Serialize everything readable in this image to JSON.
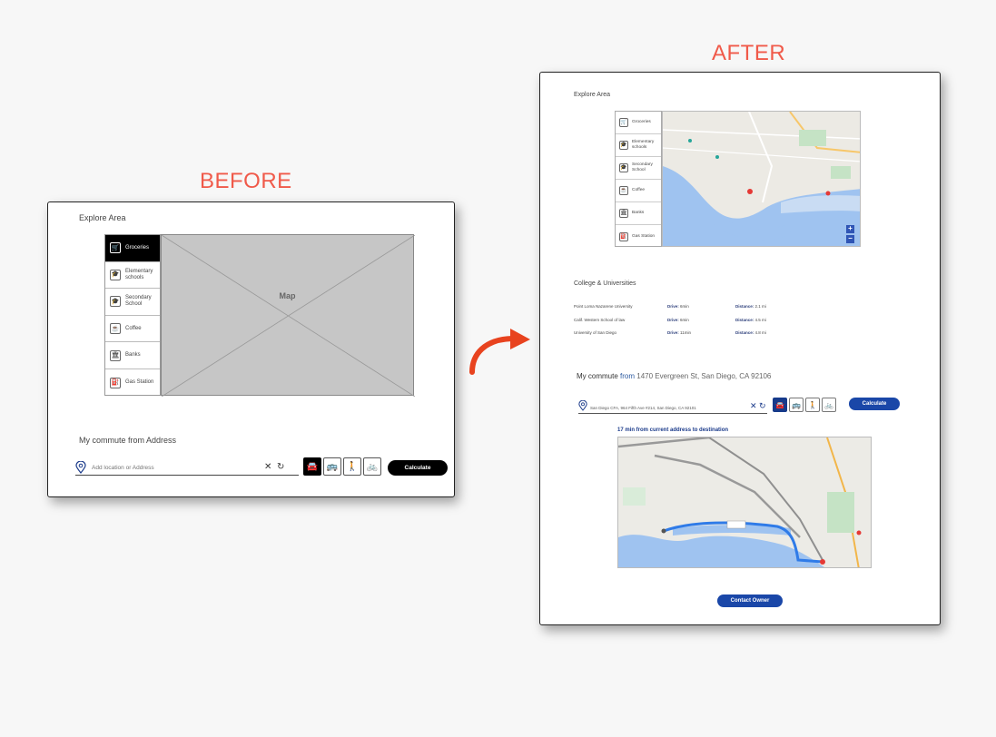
{
  "before": {
    "heading": "BEFORE",
    "explore_title": "Explore Area",
    "sidebar": [
      {
        "label": "Groceries",
        "icon": "cart-icon",
        "glyph": "🛒",
        "active": true
      },
      {
        "label": "Elementary schools",
        "icon": "school-icon",
        "glyph": "🎓",
        "active": false
      },
      {
        "label": "Secondary School",
        "icon": "school-icon",
        "glyph": "🎓",
        "active": false
      },
      {
        "label": "Coffee",
        "icon": "coffee-icon",
        "glyph": "☕",
        "active": false
      },
      {
        "label": "Banks",
        "icon": "bank-icon",
        "glyph": "🏛",
        "active": false
      },
      {
        "label": "Gas Station",
        "icon": "gas-station-icon",
        "glyph": "⛽",
        "active": false
      }
    ],
    "map_label": "Map",
    "commute_title": "My commute from Address",
    "input_placeholder": "Add location or Address",
    "calculate_label": "Calculate"
  },
  "after": {
    "heading": "AFTER",
    "explore_title": "Explore Area",
    "sidebar": [
      {
        "label": "Groceries",
        "icon": "cart-icon",
        "glyph": "🛒"
      },
      {
        "label": "Elementary schools",
        "icon": "school-icon",
        "glyph": "🎓"
      },
      {
        "label": "Secondary School",
        "icon": "school-icon",
        "glyph": "🎓"
      },
      {
        "label": "Coffee",
        "icon": "coffee-icon",
        "glyph": "☕"
      },
      {
        "label": "Banks",
        "icon": "bank-icon",
        "glyph": "🏛"
      },
      {
        "label": "Gas Station",
        "icon": "gas-station-icon",
        "glyph": "⛽"
      }
    ],
    "colleges_title": "College & Universities",
    "colleges": [
      {
        "name": "Point Loma Nazarene University",
        "drive_label": "Drive:",
        "drive": "6min",
        "distance_label": "Distance:",
        "distance": "2.1 mi"
      },
      {
        "name": "Calif. Western School of law",
        "drive_label": "Drive:",
        "drive": "6min",
        "distance_label": "Distance:",
        "distance": "4.5 mi"
      },
      {
        "name": "University of San Diego",
        "drive_label": "Drive:",
        "drive": "11min",
        "distance_label": "Distance:",
        "distance": "4.8 mi"
      }
    ],
    "commute_prefix": "My commute",
    "commute_from": "from",
    "commute_address": "1470 Evergreen St, San Diego, CA 92106",
    "input_value": "San Diego CFA, 964 Fifth Ave #214, San Diego, CA 92101",
    "calculate_label": "Calculate",
    "route_caption": "17 min from current address to destination",
    "contact_label": "Contact Owner",
    "zoom_in": "+",
    "zoom_out": "−"
  },
  "colors": {
    "heading": "#f05a4a",
    "arrow": "#e8431f",
    "primary_blue": "#1a47a8"
  }
}
